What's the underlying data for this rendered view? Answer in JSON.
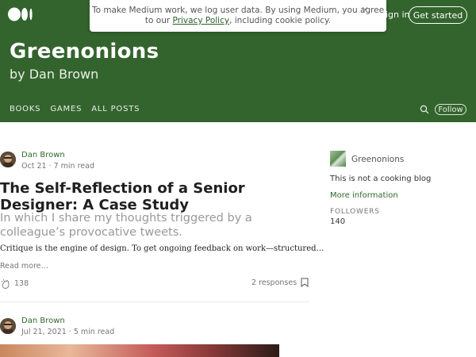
{
  "header": {
    "signin_label": "Sign in",
    "get_started_label": "Get started",
    "publication_title": "Greenonions",
    "byline": "by Dan Brown",
    "nav": [
      {
        "label": "BOOKS"
      },
      {
        "label": "GAMES"
      },
      {
        "label": "ALL POSTS"
      }
    ],
    "follow_label": "Follow",
    "icons": {
      "logo": "medium-logo-icon",
      "search": "search-icon"
    }
  },
  "cookie_banner": {
    "text_before": "To make Medium work, we log user data. By using Medium, you agree to our ",
    "link": "Privacy Policy",
    "text_after": ", including cookie policy.",
    "close": "×"
  },
  "posts": [
    {
      "author": "Dan Brown",
      "meta": "Oct 21 · 7 min read",
      "title": "The Self-Reflection of a Senior Designer: A Case Study",
      "subtitle": "In which I share my thoughts triggered by a colleague’s provocative tweets.",
      "excerpt": "Critique is the engine of design. To get ongoing feedback on work—structured…",
      "read_more": "Read more…",
      "claps": "138",
      "responses": "2 responses"
    },
    {
      "author": "Dan Brown",
      "meta": "Jul 21, 2021 · 5 min read"
    }
  ],
  "sidebar": {
    "name": "Greenonions",
    "tagline": "This is not a cooking blog",
    "more_info": "More information",
    "followers_label": "FOLLOWERS",
    "followers_count": "140"
  },
  "colors": {
    "brand": "#34642e",
    "link_green": "#2d6a2a"
  }
}
